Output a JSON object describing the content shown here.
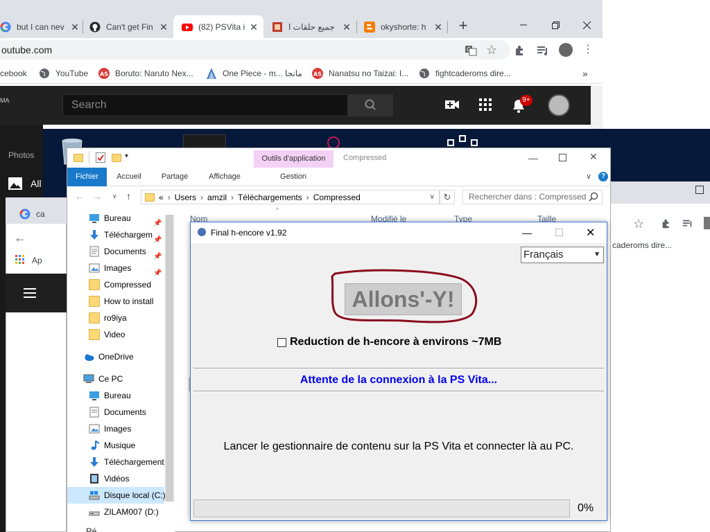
{
  "browser": {
    "tabs": [
      {
        "title": "but I can nev",
        "icon": "google-g-icon"
      },
      {
        "title": "Can't get Fin",
        "icon": "github-icon"
      },
      {
        "title": "(82) PSVita i",
        "icon": "youtube-icon"
      },
      {
        "title": "جميع حلقات ا",
        "icon": "site-icon"
      },
      {
        "title": "okyshorte: h",
        "icon": "blogger-icon"
      }
    ],
    "url": "outube.com",
    "bookmarks": [
      {
        "label": "cebook"
      },
      {
        "label": "YouTube"
      },
      {
        "label": "Boruto: Naruto Nex..."
      },
      {
        "label": "One Piece - m... مانجا"
      },
      {
        "label": "Nanatsu no Taizai: I..."
      },
      {
        "label": "fightcaderoms dire..."
      }
    ],
    "more_bookmarks": "»"
  },
  "youtube": {
    "logo_fragment": "MA",
    "search_placeholder": "Search",
    "notifications": "9+",
    "side_label": "Photos",
    "side_label2": "All"
  },
  "bg_chrome": {
    "tab_title": "ca",
    "apps": "Ap",
    "bookmark": "caderoms dire..."
  },
  "explorer": {
    "ribbon_context": "Outils d'application",
    "title": "Compressed",
    "tabs": [
      "Fichier",
      "Accueil",
      "Partage",
      "Affichage",
      "Gestion"
    ],
    "breadcrumb": [
      "«",
      "Users",
      "amzil",
      "Téléchargements",
      "Compressed"
    ],
    "search_placeholder": "Rechercher dans : Compressed",
    "columns": [
      "Nom",
      "Modifié le",
      "Type",
      "Taille"
    ],
    "quick_access": [
      {
        "label": "Bureau",
        "icon": "desktop-icon",
        "pinned": true
      },
      {
        "label": "Téléchargem",
        "icon": "download-icon",
        "pinned": true
      },
      {
        "label": "Documents",
        "icon": "documents-icon",
        "pinned": true
      },
      {
        "label": "Images",
        "icon": "images-icon",
        "pinned": true
      },
      {
        "label": "Compressed",
        "icon": "folder-icon",
        "pinned": false
      },
      {
        "label": "How to install",
        "icon": "folder-icon",
        "pinned": false
      },
      {
        "label": "ro9iya",
        "icon": "folder-icon",
        "pinned": false
      },
      {
        "label": "Video",
        "icon": "folder-icon",
        "pinned": false
      }
    ],
    "onedrive": "OneDrive",
    "this_pc": "Ce PC",
    "pc_items": [
      {
        "label": "Bureau",
        "icon": "desktop-icon"
      },
      {
        "label": "Documents",
        "icon": "documents-icon"
      },
      {
        "label": "Images",
        "icon": "images-icon"
      },
      {
        "label": "Musique",
        "icon": "music-icon"
      },
      {
        "label": "Téléchargement",
        "icon": "download-icon"
      },
      {
        "label": "Vidéos",
        "icon": "video-icon"
      },
      {
        "label": "Disque local (C:)",
        "icon": "drive-icon"
      },
      {
        "label": "ZILAM007 (D:)",
        "icon": "usb-drive-icon"
      }
    ],
    "network_fragment": "Ré..."
  },
  "dialog": {
    "title": "Final h-encore v1.92",
    "language": "Français",
    "go_button": "Allons'-Y!",
    "checkbox_label": "Reduction de h-encore à environs ~7MB",
    "checkbox_checked": false,
    "status": "Attente de la connexion à la PS Vita...",
    "instructions": "Lancer le gestionnaire de contenu sur la PS Vita et connecter là au PC.",
    "progress": "0%",
    "progress_value": 0,
    "status_color": "#0000ee",
    "annotation_color": "#8b0a1e"
  }
}
